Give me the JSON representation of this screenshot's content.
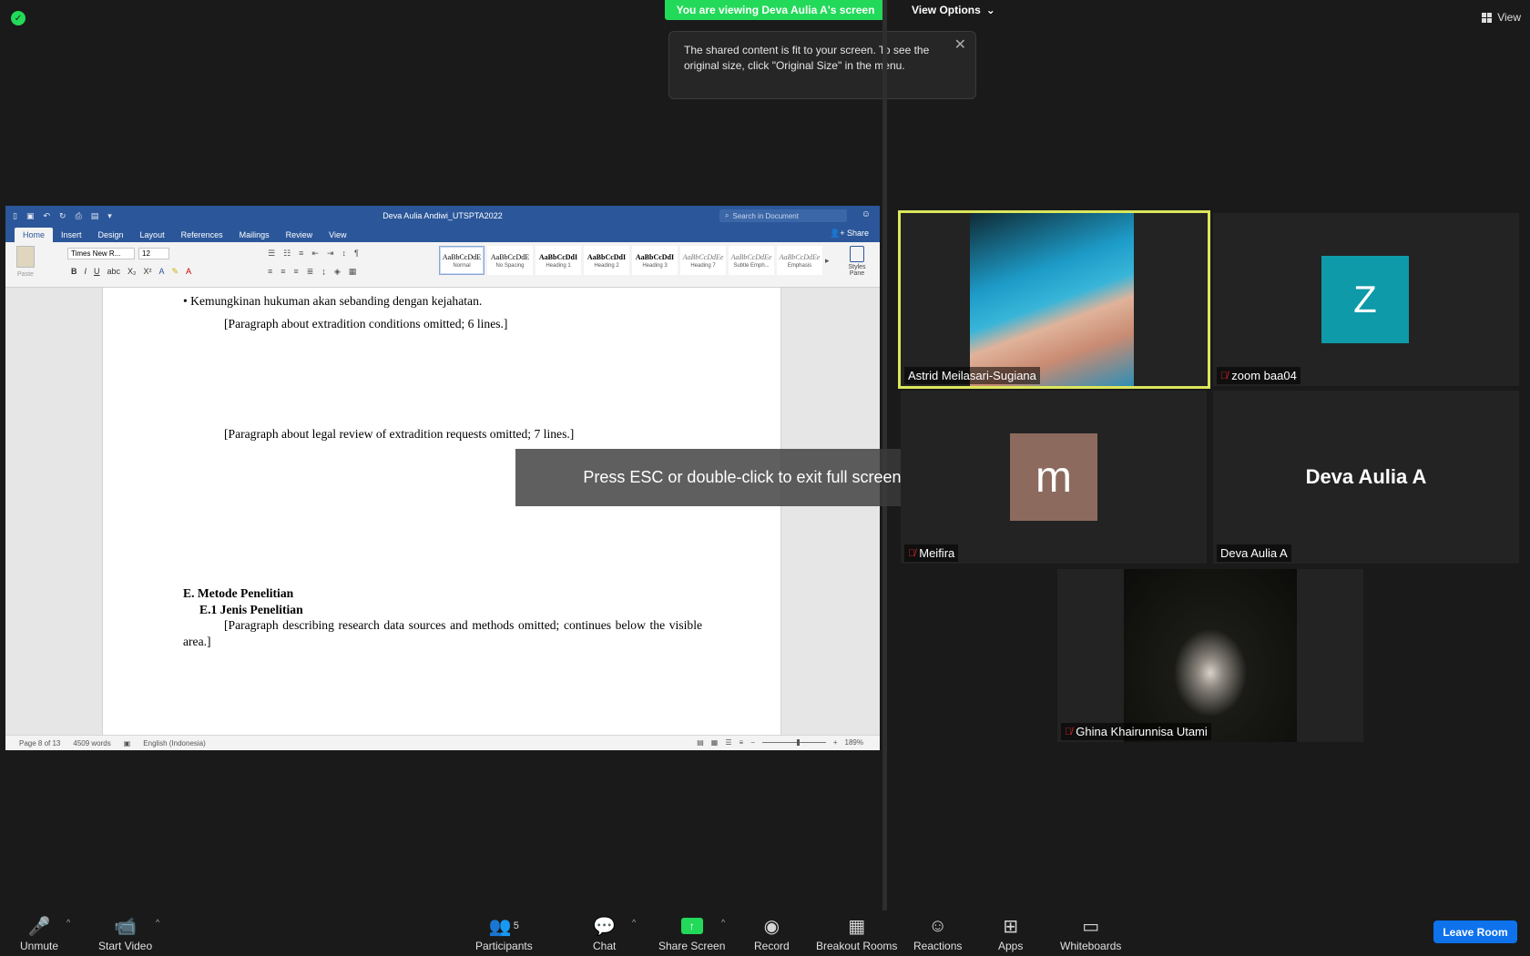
{
  "meeting": {
    "viewing_banner": "You are viewing Deva Aulia A's screen",
    "view_options_label": "View Options",
    "view_label": "View",
    "tooltip_text": "The shared content is fit to your screen. To see the original size, click \"Original Size\" in the menu.",
    "esc_message": "Press ESC or double-click to exit full screen mode"
  },
  "word": {
    "doc_title": "Deva Aulia Andiwi_UTSPTA2022",
    "search_placeholder": "Search in Document",
    "tabs": [
      "Home",
      "Insert",
      "Design",
      "Layout",
      "References",
      "Mailings",
      "Review",
      "View"
    ],
    "share_label": "Share",
    "paste_label": "Paste",
    "font_name": "Times New R...",
    "font_size": "12",
    "styles": [
      {
        "preview": "AaBbCcDdE",
        "label": "Normal"
      },
      {
        "preview": "AaBbCcDdE",
        "label": "No Spacing"
      },
      {
        "preview": "AaBbCcDdI",
        "label": "Heading 1"
      },
      {
        "preview": "AaBbCcDdI",
        "label": "Heading 2"
      },
      {
        "preview": "AaBbCcDdI",
        "label": "Heading 3"
      },
      {
        "preview": "AaBbCcDdEe",
        "label": "Heading 7"
      },
      {
        "preview": "AaBbCcDdEe",
        "label": "Subtle Emph..."
      },
      {
        "preview": "AaBbCcDdEe",
        "label": "Emphasis"
      }
    ],
    "styles_pane_label": "Styles Pane",
    "body": {
      "bullet": "• Kemungkinan hukuman akan sebanding dengan kejahatan.",
      "paragraph1": "[Paragraph about extradition conditions omitted; 6 lines.]",
      "paragraph2": "[Paragraph about legal review of extradition requests omitted; 7 lines.]",
      "heading": "E. Metode Penelitian",
      "subheading": "E.1 Jenis Penelitian",
      "paragraph3": "[Paragraph describing research data sources and methods omitted; continues below the visible area.]"
    },
    "status": {
      "page": "Page 8 of 13",
      "words": "4509 words",
      "language": "English (Indonesia)",
      "zoom": "189%"
    }
  },
  "participants": [
    {
      "name": "Astrid Meilasari-Sugiana",
      "muted": false,
      "active_speaker": true
    },
    {
      "name": "zoom baa04",
      "muted": true,
      "avatar_letter": "Z",
      "avatar_color": "#0e9aa8"
    },
    {
      "name": "Meifira",
      "muted": true,
      "avatar_letter": "m",
      "avatar_color": "#8c6b5e"
    },
    {
      "name": "Deva Aulia A",
      "muted": false,
      "big_name": "Deva Aulia A"
    },
    {
      "name": "Ghina Khairunnisa Utami",
      "muted": true
    }
  ],
  "toolbar": {
    "unmute": "Unmute",
    "start_video": "Start Video",
    "participants": "Participants",
    "participants_count": "5",
    "chat": "Chat",
    "share_screen": "Share Screen",
    "record": "Record",
    "breakout_rooms": "Breakout Rooms",
    "reactions": "Reactions",
    "apps": "Apps",
    "whiteboards": "Whiteboards",
    "leave": "Leave Room"
  },
  "colors": {
    "accent_green": "#23d959",
    "word_blue": "#2b579a",
    "leave_blue": "#0e72ed",
    "active_border": "#dce65c"
  }
}
